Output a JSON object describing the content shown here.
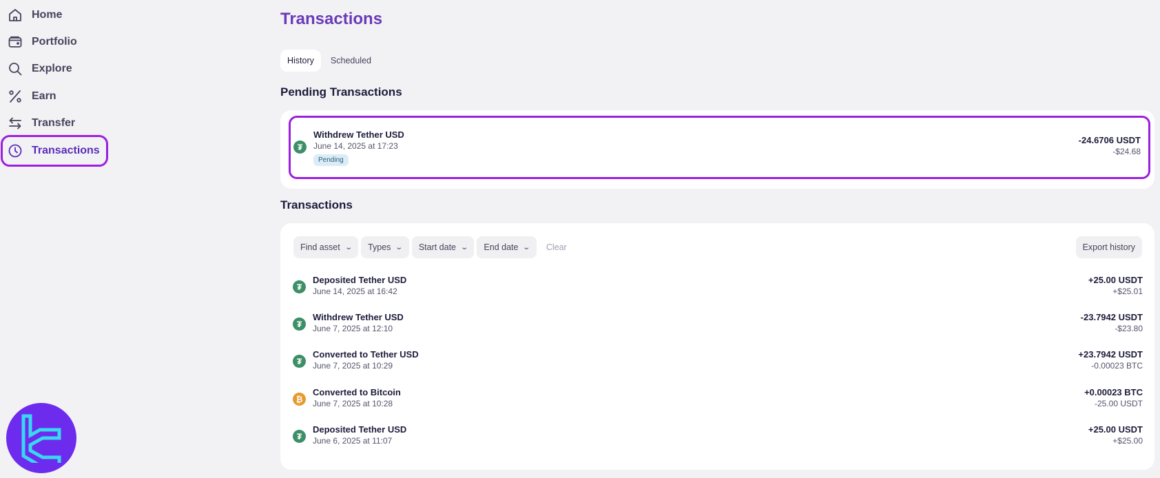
{
  "sidebar": {
    "items": [
      {
        "label": "Home",
        "icon": "home-icon"
      },
      {
        "label": "Portfolio",
        "icon": "wallet-icon"
      },
      {
        "label": "Explore",
        "icon": "search-icon"
      },
      {
        "label": "Earn",
        "icon": "percent-icon"
      },
      {
        "label": "Transfer",
        "icon": "transfer-arrows-icon"
      },
      {
        "label": "Transactions",
        "icon": "clock-icon",
        "active": true
      }
    ]
  },
  "page": {
    "title": "Transactions",
    "tabs": [
      {
        "label": "History",
        "active": true
      },
      {
        "label": "Scheduled",
        "active": false
      }
    ]
  },
  "pending": {
    "heading": "Pending Transactions",
    "items": [
      {
        "title": "Withdrew Tether USD",
        "date": "June 14, 2025 at 17:23",
        "status": "Pending",
        "amount": "-24.6706 USDT",
        "fiat": "-$24.68",
        "coin": "usdt"
      }
    ]
  },
  "transactions": {
    "heading": "Transactions",
    "filters": [
      "Find asset",
      "Types",
      "Start date",
      "End date"
    ],
    "clear_label": "Clear",
    "export_label": "Export history",
    "items": [
      {
        "title": "Deposited Tether USD",
        "date": "June 14, 2025 at 16:42",
        "amount": "+25.00 USDT",
        "sub": "+$25.01",
        "coin": "usdt"
      },
      {
        "title": "Withdrew Tether USD",
        "date": "June 7, 2025 at 12:10",
        "amount": "-23.7942 USDT",
        "sub": "-$23.80",
        "coin": "usdt"
      },
      {
        "title": "Converted to Tether USD",
        "date": "June 7, 2025 at 10:29",
        "amount": "+23.7942 USDT",
        "sub": "-0.00023 BTC",
        "coin": "usdt"
      },
      {
        "title": "Converted to Bitcoin",
        "date": "June 7, 2025 at 10:28",
        "amount": "+0.00023 BTC",
        "sub": "-25.00 USDT",
        "coin": "btc"
      },
      {
        "title": "Deposited Tether USD",
        "date": "June 6, 2025 at 11:07",
        "amount": "+25.00 USDT",
        "sub": "+$25.00",
        "coin": "usdt"
      }
    ]
  },
  "colors": {
    "accent": "#6a3ab8",
    "highlight": "#9b1fe0",
    "usdt": "#3d8f68",
    "btc": "#e59a2f",
    "logo_bg": "#6d2bee"
  }
}
